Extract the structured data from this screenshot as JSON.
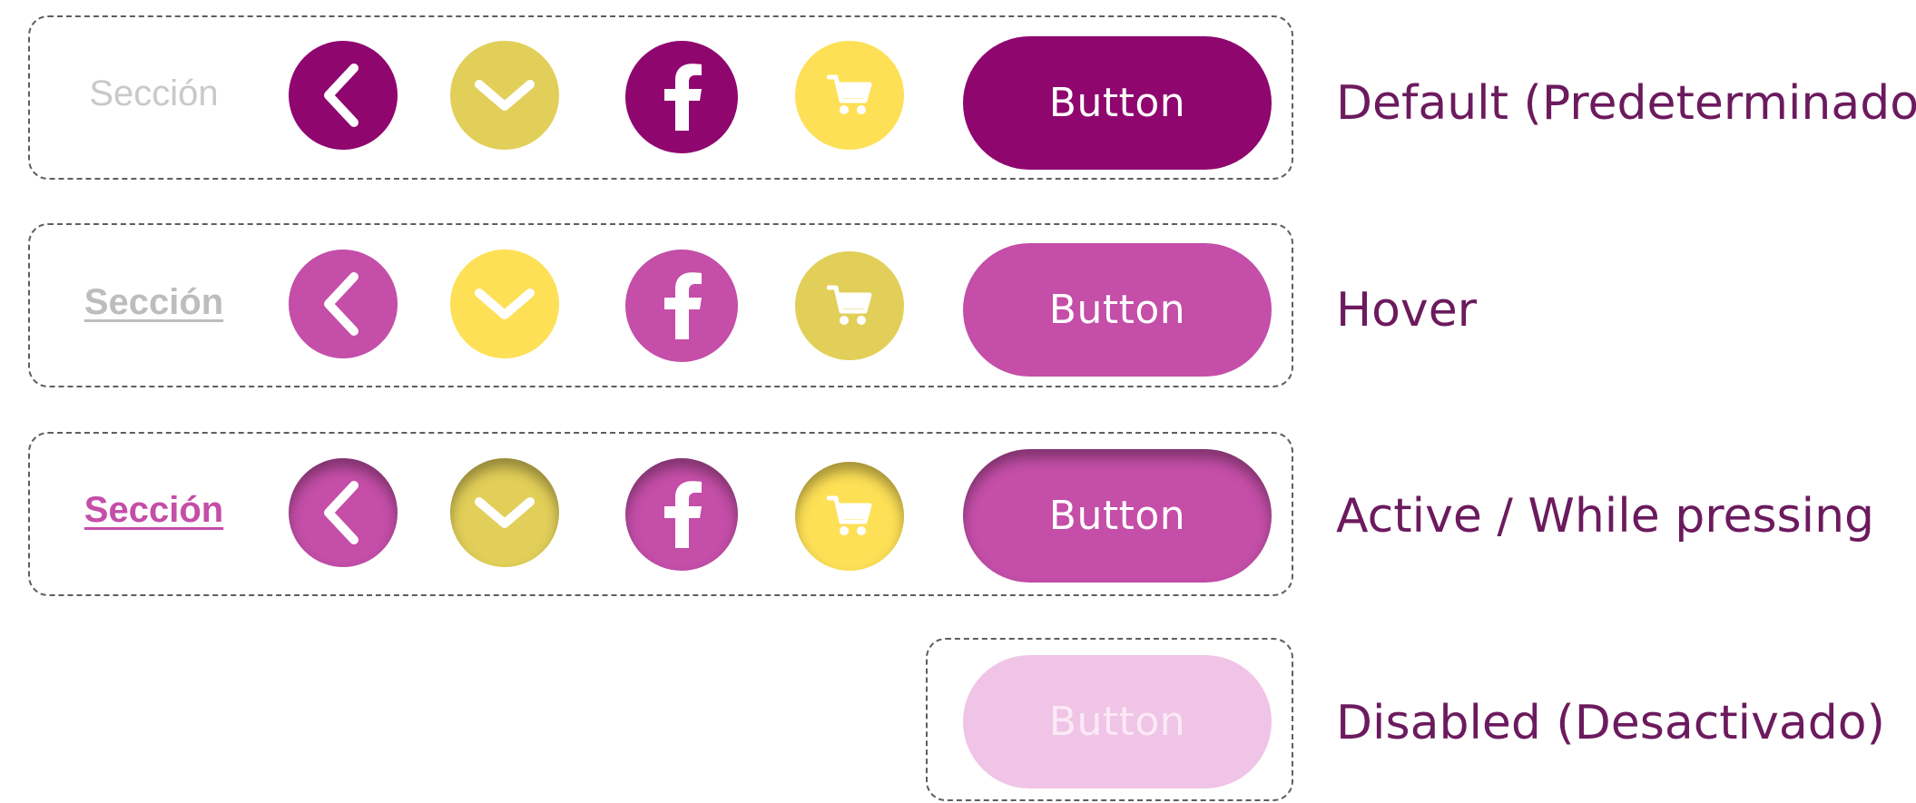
{
  "colors": {
    "purple_default": "#8f066f",
    "magenta_hover": "#c44ea8",
    "mustard": "#e2cf59",
    "yellow": "#fde056",
    "pink_disabled": "#f0c4e6",
    "label_text": "#6c1a5e"
  },
  "icons": [
    "chevron-left-icon",
    "chevron-down-icon",
    "facebook-icon",
    "shopping-cart-icon"
  ],
  "states": [
    {
      "label": "Default (Predeterminado)",
      "link_text": "Sección",
      "button_label": "Button"
    },
    {
      "label": "Hover",
      "link_text": "Sección",
      "button_label": "Button"
    },
    {
      "label": "Active / While pressing",
      "link_text": "Sección",
      "button_label": "Button"
    },
    {
      "label": "Disabled (Desactivado)",
      "button_label": "Button"
    }
  ]
}
